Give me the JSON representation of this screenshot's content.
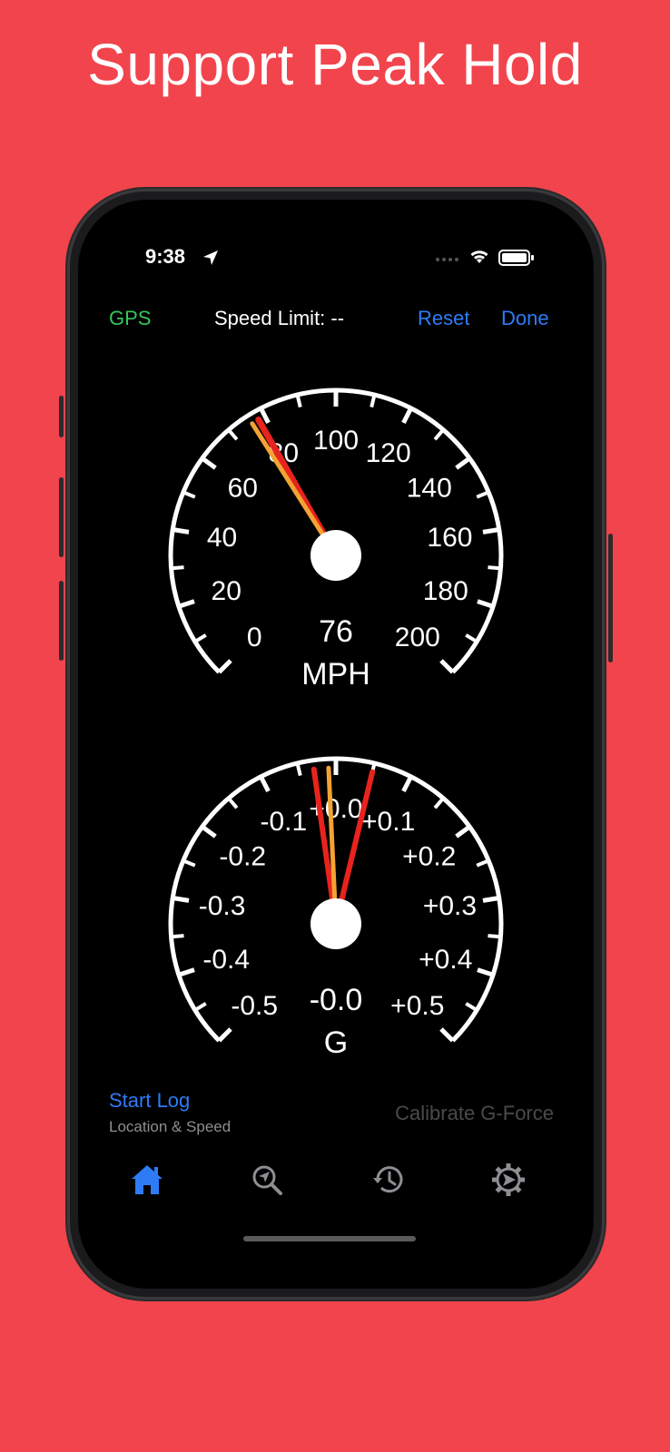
{
  "headline": "Support Peak Hold",
  "status": {
    "time": "9:38"
  },
  "navbar": {
    "gps": "GPS",
    "speed_limit": "Speed Limit: --",
    "reset": "Reset",
    "done": "Done"
  },
  "speed_gauge": {
    "tick_labels": [
      "0",
      "20",
      "40",
      "60",
      "80",
      "100",
      "120",
      "140",
      "160",
      "180",
      "200"
    ],
    "value": "76",
    "unit": "MPH",
    "current": 76,
    "peak": 78,
    "needle_color": "#f4a233",
    "peak_color": "#e8231d"
  },
  "g_gauge": {
    "tick_labels": [
      "-0.5",
      "-0.4",
      "-0.3",
      "-0.2",
      "-0.1",
      "+0.0",
      "+0.1",
      "+0.2",
      "+0.3",
      "+0.4",
      "+0.5"
    ],
    "value": "-0.0",
    "unit": "G",
    "current": -0.01,
    "peak_low": -0.03,
    "peak_high": 0.05,
    "needle_color": "#f4a233",
    "peak_color": "#e8231d"
  },
  "bottom": {
    "start_log": "Start Log",
    "start_log_sub": "Location & Speed",
    "calibrate": "Calibrate G-Force"
  },
  "tabs": [
    {
      "icon": "home-icon",
      "active": true
    },
    {
      "icon": "location-search-icon",
      "active": false
    },
    {
      "icon": "history-icon",
      "active": false
    },
    {
      "icon": "settings-icon",
      "active": false
    }
  ],
  "colors": {
    "background": "#f2444c",
    "accent": "#2f7bf6",
    "gps": "#34c759"
  }
}
